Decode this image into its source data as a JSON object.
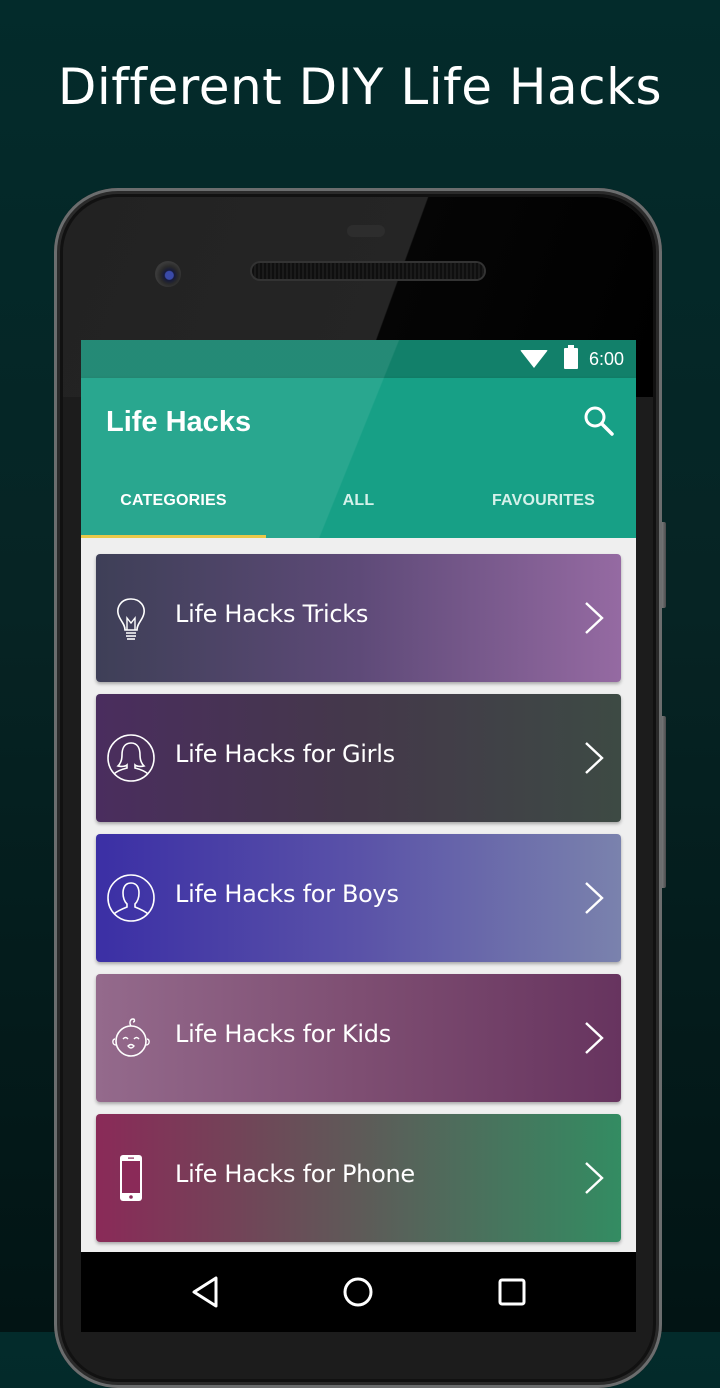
{
  "headline": "Different DIY Life Hacks",
  "status_bar": {
    "time": "6:00",
    "icons": [
      "wifi-icon",
      "battery-icon"
    ]
  },
  "app_bar": {
    "title": "Life Hacks",
    "action_icon": "search-icon"
  },
  "tabs": [
    {
      "label": "CATEGORIES",
      "active": true
    },
    {
      "label": "ALL",
      "active": false
    },
    {
      "label": "FAVOURITES",
      "active": false
    }
  ],
  "categories": [
    {
      "label": "Life Hacks Tricks",
      "icon": "lightbulb-icon",
      "gradient": [
        "#3e3f57",
        "#5e4a78",
        "#956aa2"
      ]
    },
    {
      "label": "Life Hacks for Girls",
      "icon": "girl-avatar-icon",
      "gradient": [
        "#4a2d5e",
        "#44384a",
        "#3d4a44"
      ]
    },
    {
      "label": "Life Hacks for Boys",
      "icon": "boy-avatar-icon",
      "gradient": [
        "#3b2fa5",
        "#5a52a8",
        "#7a82ad"
      ]
    },
    {
      "label": "Life Hacks for Kids",
      "icon": "baby-face-icon",
      "gradient": [
        "#946a8c",
        "#7e4e72",
        "#67345f"
      ]
    },
    {
      "label": "Life Hacks for Phone",
      "icon": "smartphone-icon",
      "gradient": [
        "#8a2a58",
        "#5e5a58",
        "#338c62"
      ]
    }
  ],
  "nav_bar": {
    "buttons": [
      "back-icon",
      "home-icon",
      "recents-icon"
    ]
  },
  "colors": {
    "primary": "#17a086",
    "primary_dark": "#12806a",
    "accent": "#e8c43a",
    "background": "#032b2b"
  }
}
